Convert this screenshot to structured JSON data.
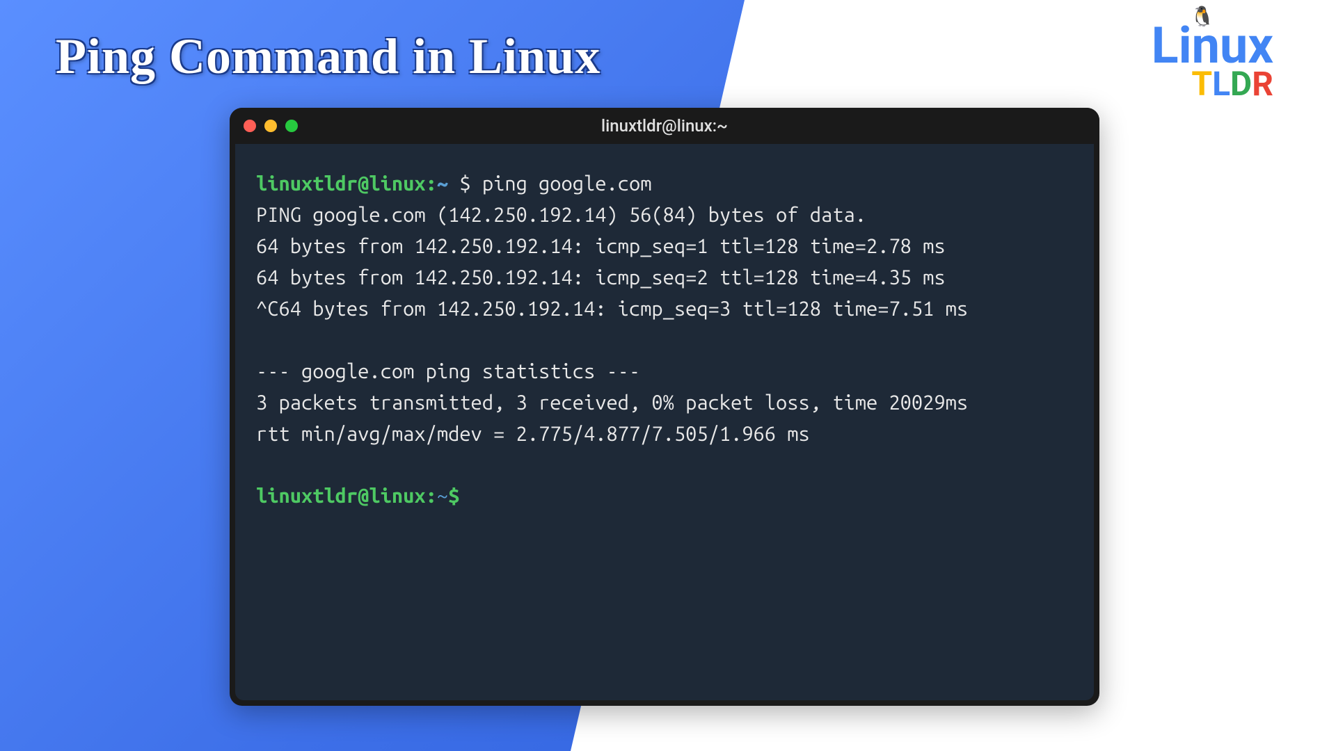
{
  "header": {
    "title": "Ping Command in Linux"
  },
  "logo": {
    "text": "Linux",
    "subtext_t": "T",
    "subtext_l": "L",
    "subtext_d": "D",
    "subtext_r": "R"
  },
  "terminal": {
    "title": "linuxtldr@linux:~",
    "prompt_user": "linuxtldr@linux",
    "prompt_colon": ":",
    "prompt_tilde": "~",
    "prompt_dollar_space": " $ ",
    "command": "ping google.com",
    "output": [
      "PING google.com (142.250.192.14) 56(84) bytes of data.",
      "64 bytes from 142.250.192.14: icmp_seq=1 ttl=128 time=2.78 ms",
      "64 bytes from 142.250.192.14: icmp_seq=2 ttl=128 time=4.35 ms",
      "^C64 bytes from 142.250.192.14: icmp_seq=3 ttl=128 time=7.51 ms"
    ],
    "stats": [
      "--- google.com ping statistics ---",
      "3 packets transmitted, 3 received, 0% packet loss, time 20029ms",
      "rtt min/avg/max/mdev = 2.775/4.877/7.505/1.966 ms"
    ],
    "prompt2_dollar": "$"
  }
}
